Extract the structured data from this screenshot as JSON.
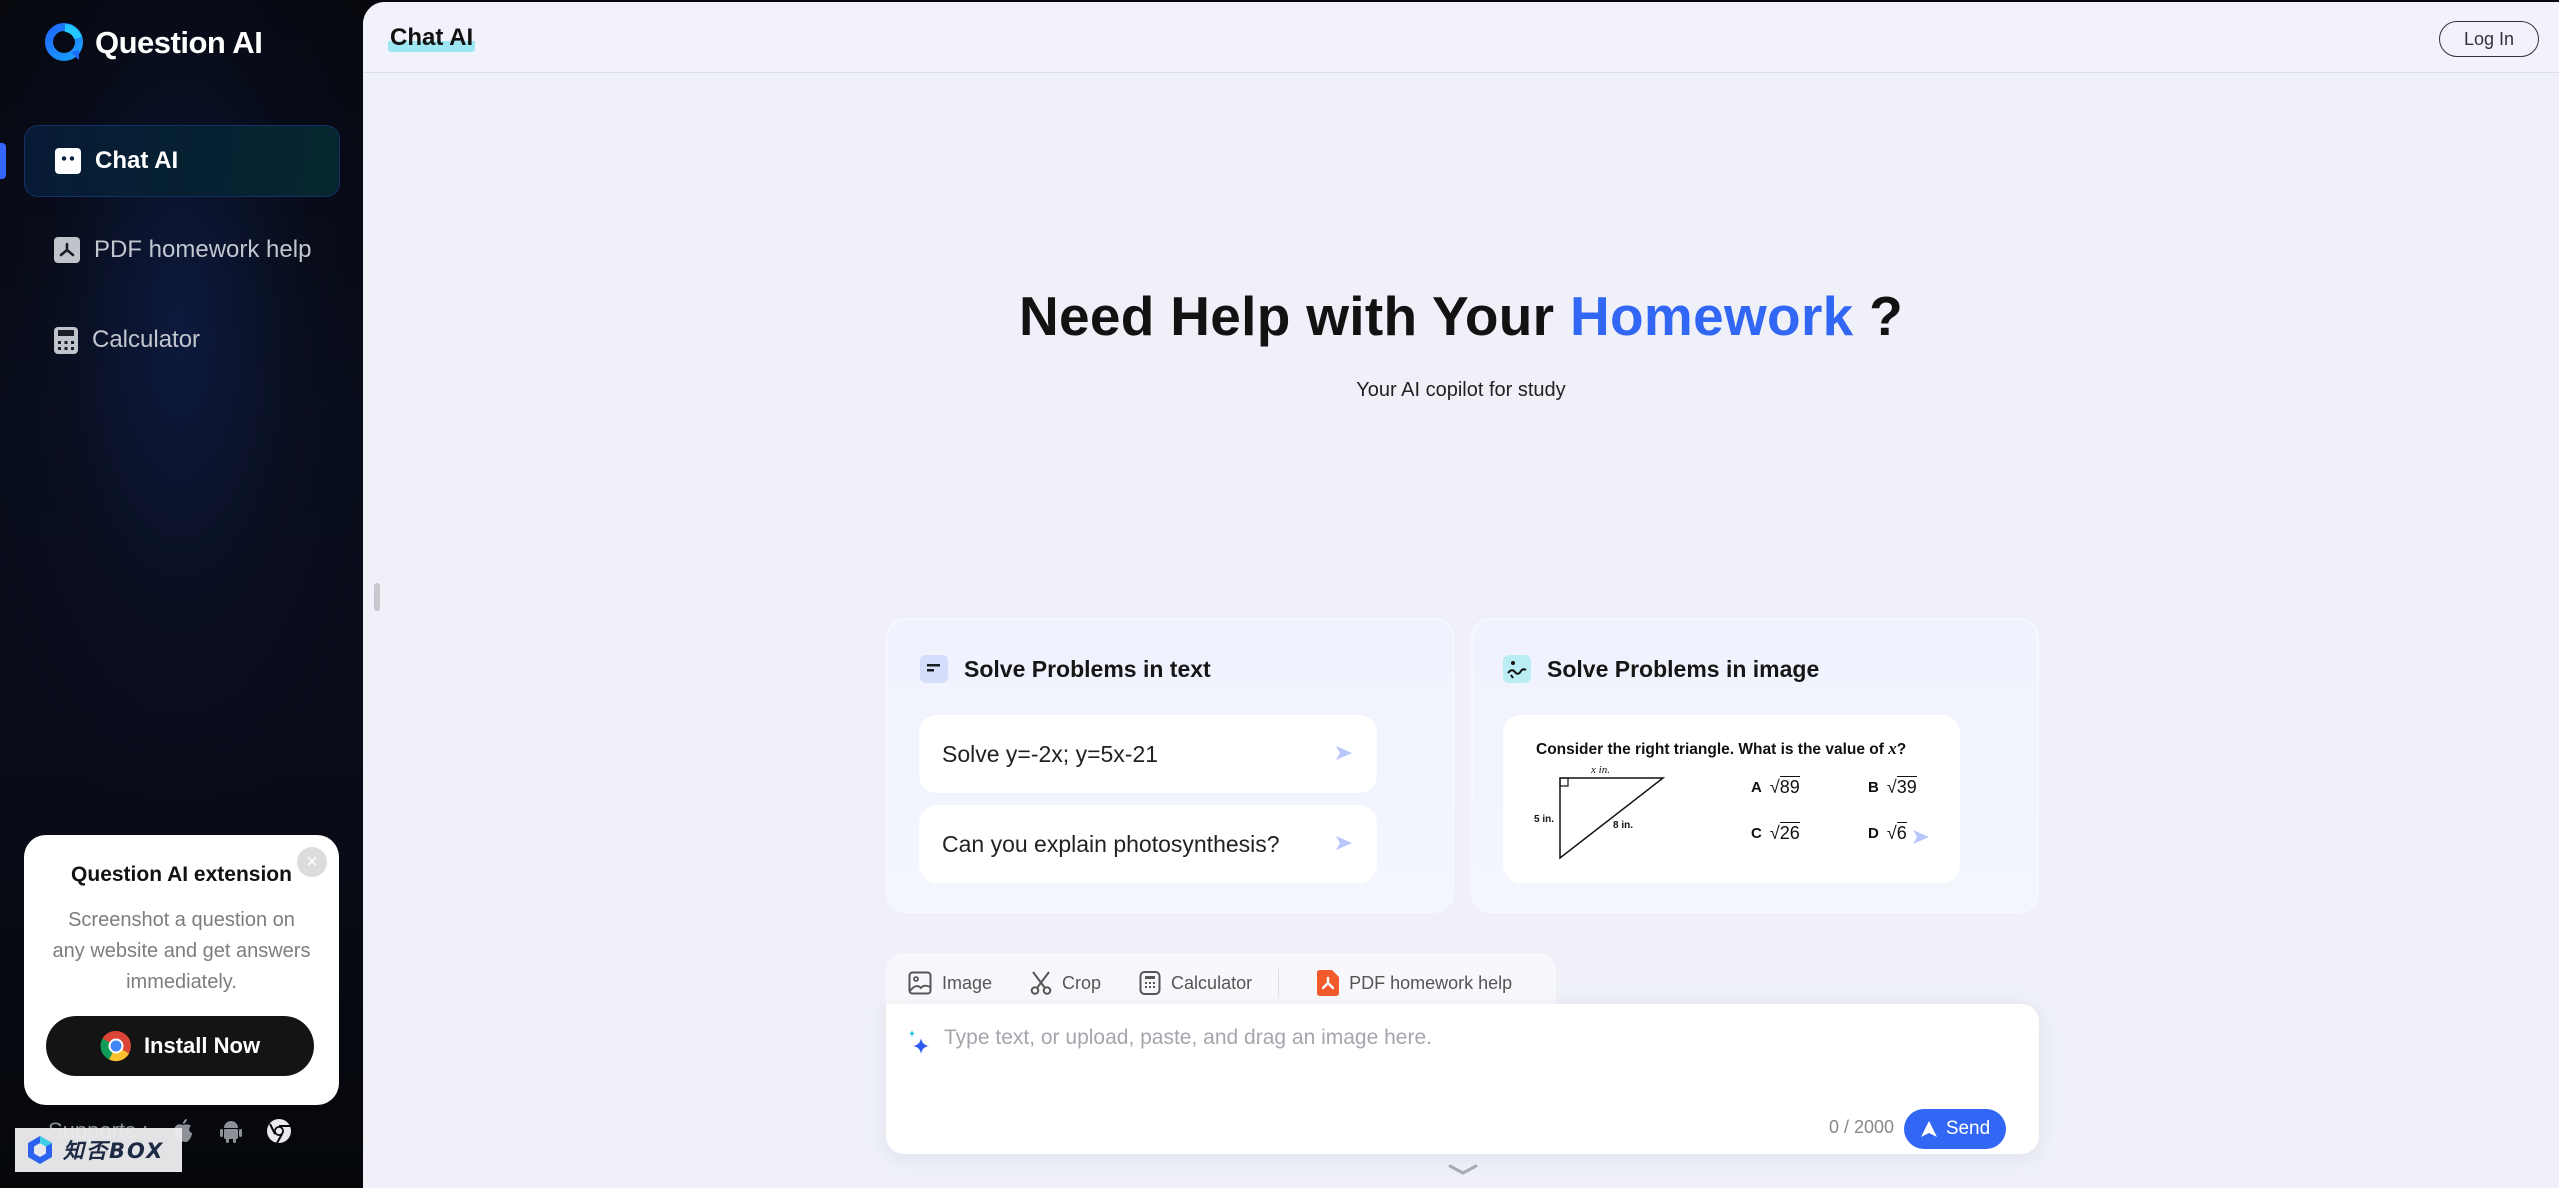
{
  "app": {
    "name": "Question AI",
    "brand_color": "#3266f4"
  },
  "sidebar": {
    "items": [
      {
        "label": "Chat AI",
        "icon": "chat-bubble-icon",
        "active": true
      },
      {
        "label": "PDF homework help",
        "icon": "pdf-icon",
        "active": false
      },
      {
        "label": "Calculator",
        "icon": "calculator-icon",
        "active": false
      }
    ],
    "extension_card": {
      "title": "Question AI extension",
      "description": "Screenshot a question on any website and get answers immediately.",
      "install_label": "Install Now",
      "close_icon": "close-icon"
    },
    "supports": {
      "label": "Supports :",
      "platforms": [
        "apple-icon",
        "android-icon",
        "chrome-icon"
      ]
    },
    "watermark": "知否BOX"
  },
  "header": {
    "title": "Chat AI",
    "login_label": "Log In"
  },
  "hero": {
    "title_prefix": "Need Help with Your ",
    "title_accent": "Homework",
    "title_suffix": " ?",
    "subtitle": "Your AI copilot for study"
  },
  "cards": {
    "text": {
      "title": "Solve Problems in text",
      "prompts": [
        "Solve y=-2x; y=5x-21",
        "Can you explain photosynthesis?"
      ]
    },
    "image": {
      "title": "Solve Problems in image",
      "question": "Consider the right triangle.  What is the value of ",
      "variable": "x",
      "question_end": "?",
      "triangle_labels": {
        "top": "x in.",
        "left": "5 in.",
        "hypotenuse": "8 in."
      },
      "options": [
        {
          "letter": "A",
          "radicand": "89"
        },
        {
          "letter": "B",
          "radicand": "39"
        },
        {
          "letter": "C",
          "radicand": "26"
        },
        {
          "letter": "D",
          "radicand": "6"
        }
      ]
    }
  },
  "composer": {
    "tools": [
      {
        "label": "Image",
        "icon": "image-icon"
      },
      {
        "label": "Crop",
        "icon": "scissors-icon"
      },
      {
        "label": "Calculator",
        "icon": "calculator-icon"
      },
      {
        "label": "PDF homework help",
        "icon": "pdf-icon"
      }
    ],
    "placeholder": "Type text, or upload, paste, and drag an image here.",
    "value": "",
    "counter": "0 / 2000",
    "send_label": "Send"
  }
}
